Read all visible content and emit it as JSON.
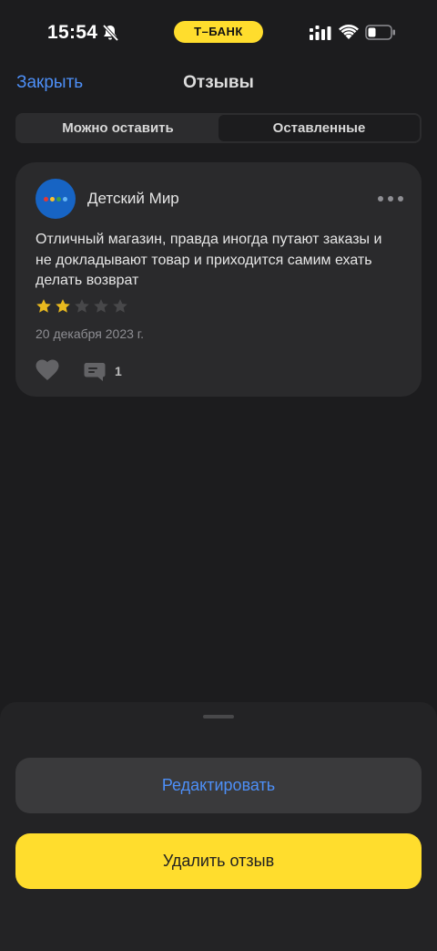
{
  "status_bar": {
    "time": "15:54",
    "bank_label": "Т–БАНК"
  },
  "header": {
    "close_label": "Закрыть",
    "title": "Отзывы"
  },
  "tabs": [
    {
      "label": "Можно оставить",
      "active": false
    },
    {
      "label": "Оставленные",
      "active": true
    }
  ],
  "review": {
    "store_name": "Детский Мир",
    "text": "Отличный магазин, правда иногда путают заказы и не докладывают товар и приходится самим ехать делать возврат",
    "rating": 2,
    "max_rating": 5,
    "date": "20 декабря 2023 г.",
    "comment_count": "1",
    "logo_color": "#1764c4",
    "star_filled_color": "#e8b91f",
    "star_empty_color": "#48484a"
  },
  "actions": {
    "edit_label": "Редактировать",
    "delete_label": "Удалить отзыв"
  },
  "colors": {
    "accent": "#4d8ff7",
    "brand_yellow": "#ffdd2d",
    "background": "#1c1c1e"
  }
}
